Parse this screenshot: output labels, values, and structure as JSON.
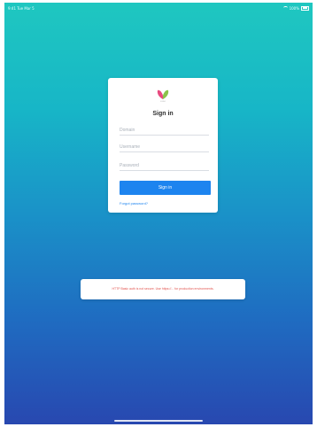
{
  "status": {
    "left": "9:41 Tue Mar 5",
    "right": "100%"
  },
  "card": {
    "logo_text": "LOGO",
    "title": "Sign in",
    "domain_placeholder": "Domain",
    "username_placeholder": "Username",
    "password_placeholder": "Password",
    "signin_label": "Sign in",
    "forgot_label": "Forgot password?"
  },
  "warning": {
    "text": "HTTP Basic auth is not secure. Use https://... for production environments."
  },
  "colors": {
    "primary": "#1d84ef",
    "warning": "#e2534e",
    "gradient_top": "#1fc7c0",
    "gradient_bottom": "#2848b0"
  }
}
